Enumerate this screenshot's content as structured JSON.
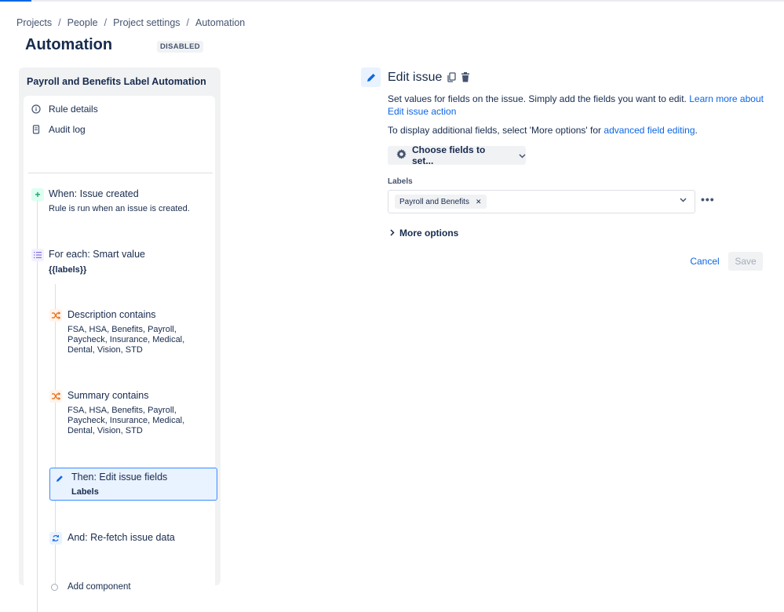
{
  "breadcrumb": [
    "Projects",
    "People",
    "Project settings",
    "Automation"
  ],
  "page": {
    "title": "Automation",
    "status": "DISABLED"
  },
  "rule": {
    "name": "Payroll and Benefits Label Automation",
    "nav": [
      {
        "label": "Rule details",
        "icon": "info-icon"
      },
      {
        "label": "Audit log",
        "icon": "document-icon"
      }
    ],
    "components": {
      "trigger": {
        "title": "When: Issue created",
        "desc": "Rule is run when an issue is created."
      },
      "branch": {
        "title": "For each: Smart value",
        "desc": "{{labels}}"
      },
      "condition1": {
        "title": "Description contains",
        "desc": [
          "FSA, HSA, Benefits, Payroll,",
          "Paycheck, Insurance, Medical,",
          "Dental, Vision, STD"
        ]
      },
      "condition2": {
        "title": "Summary contains",
        "desc": [
          "FSA, HSA, Benefits, Payroll,",
          "Paycheck, Insurance, Medical,",
          "Dental, Vision, STD"
        ]
      },
      "action1": {
        "title": "Then: Edit issue fields",
        "desc": "Labels"
      },
      "action2": {
        "title": "And: Re-fetch issue data"
      },
      "add": "Add component"
    }
  },
  "editor": {
    "title": "Edit issue",
    "description": "Set values for fields on the issue. Simply add the fields you want to edit.",
    "learn_more": "Learn more about Edit issue action",
    "additional_prefix": "To display additional fields, select 'More options' for",
    "advanced_link": "advanced field editing",
    "advanced_suffix": ".",
    "choose_fields": "Choose fields to set...",
    "labels_field": {
      "label": "Labels",
      "value": "Payroll and Benefits"
    },
    "more_options": "More options",
    "cancel": "Cancel",
    "save": "Save"
  },
  "colors": {
    "accent": "#0c66e4",
    "selected_border": "#388bff",
    "selected_bg": "#e9f2ff",
    "trigger": "#22a06b",
    "condition": "#e56910"
  }
}
